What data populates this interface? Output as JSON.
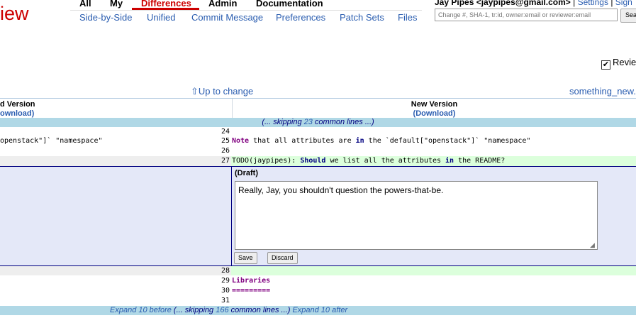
{
  "app": {
    "logo_text": "iew"
  },
  "main_menu": [
    {
      "label": "All"
    },
    {
      "label": "My"
    },
    {
      "label": "Differences"
    },
    {
      "label": "Admin"
    },
    {
      "label": "Documentation"
    }
  ],
  "sub_menu": [
    {
      "label": "Side-by-Side"
    },
    {
      "label": "Unified"
    },
    {
      "label": "Commit Message"
    },
    {
      "label": "Preferences"
    },
    {
      "label": "Patch Sets"
    },
    {
      "label": "Files"
    }
  ],
  "user": {
    "name": "Jay Pipes <jaypipes@gmail.com>",
    "separator": "|",
    "settings": "Settings",
    "sign_out": "Sign"
  },
  "search": {
    "placeholder": "Change #, SHA-1, tr:id, owner:email or reviewer:email",
    "button_label": "Sea"
  },
  "reviewed": {
    "check": "✔",
    "label": "Revie"
  },
  "nav": {
    "up_to_change": "⇧Up to change",
    "next_file": "something_new.t"
  },
  "diff_header": {
    "old_title": "d Version",
    "old_download": "ownload)",
    "new_title": "New Version",
    "new_download": "(Download)"
  },
  "skip_top": {
    "prefix": "(... skipping ",
    "count": "23",
    "suffix": " common lines ...)"
  },
  "lines": {
    "l24": "24",
    "l25": "25",
    "l26": "26",
    "l27": "27",
    "l28": "28",
    "l29": "29",
    "l30": "30",
    "l31": "31",
    "old_25": "openstack\"]` \"namespace\"",
    "new_25_kw1": "Note",
    "new_25_a": " that all attributes are ",
    "new_25_kw2": "in",
    "new_25_b": " the `default[\"openstack\"]` \"namespace\"",
    "new_27_a": "TODO(jaypipes): ",
    "new_27_kw1": "Should",
    "new_27_b": " we list all the attributes ",
    "new_27_kw2": "in",
    "new_27_c": " the README?",
    "new_29": "Libraries",
    "new_30": "========="
  },
  "comment": {
    "draft_label": "(Draft)",
    "text": "Really, Jay, you shouldn't question the powers-that-be.",
    "save": "Save",
    "discard": "Discard",
    "grip": "◢"
  },
  "skip_bottom": {
    "expand_before": "Expand 10 before",
    "prefix": " (... skipping ",
    "count": "166",
    "suffix": " common lines ...) ",
    "expand_after": "Expand 10 after"
  },
  "colors": {
    "accent": "#cc0000",
    "link": "#2a5db0",
    "skip_bg": "#b0d8e6",
    "added_bg": "#dcffdc",
    "comment_bg": "#e4e8f8"
  }
}
